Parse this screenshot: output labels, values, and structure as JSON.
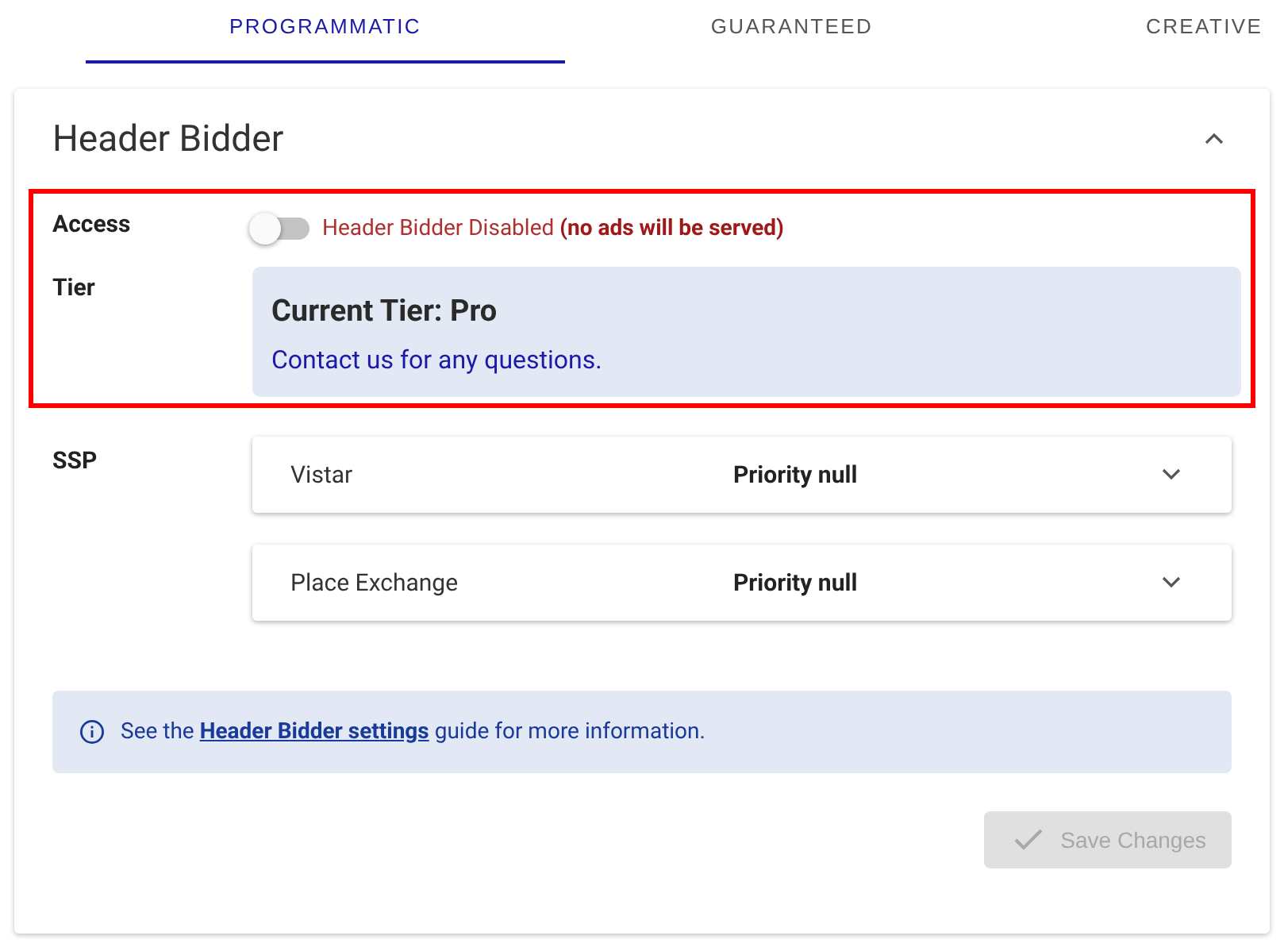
{
  "tabs": [
    {
      "label": "PROGRAMMATIC",
      "selected": true
    },
    {
      "label": "GUARANTEED",
      "selected": false
    },
    {
      "label": "CREATIVE",
      "selected": false
    }
  ],
  "panel": {
    "title": "Header Bidder",
    "expanded": true,
    "access": {
      "label": "Access",
      "on": false,
      "status": "Header Bidder Disabled",
      "note": "(no ads will be served)"
    },
    "tier": {
      "label": "Tier",
      "heading": "Current Tier: Pro",
      "contact": "Contact us for any questions."
    },
    "ssp": {
      "label": "SSP",
      "items": [
        {
          "name": "Vistar",
          "priority": "Priority null",
          "expanded": false
        },
        {
          "name": "Place Exchange",
          "priority": "Priority null",
          "expanded": false
        }
      ]
    },
    "info": {
      "before": "See the",
      "link": "Header Bidder settings",
      "after": "guide for more information."
    },
    "save_button": {
      "label": "Save Changes",
      "disabled": true
    }
  }
}
